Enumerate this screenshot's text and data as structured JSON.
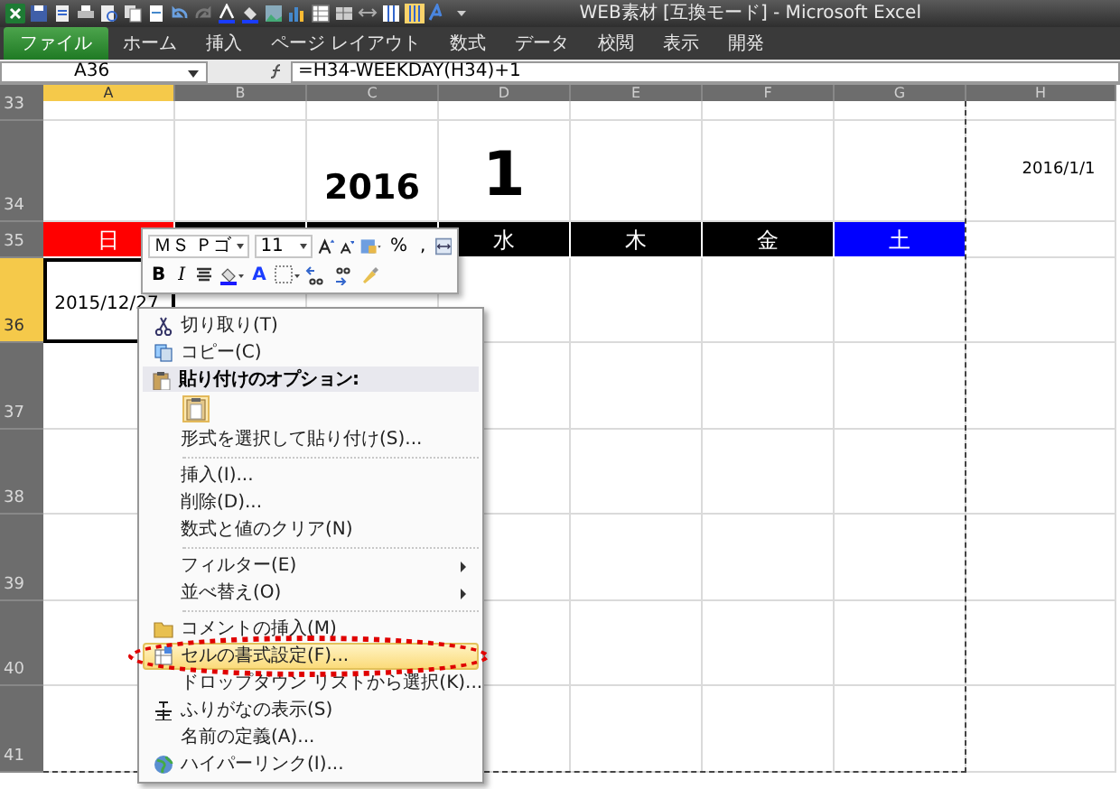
{
  "window": {
    "title": "WEB素材  [互換モード]  -  Microsoft Excel"
  },
  "tabs": [
    {
      "label": "ファイル",
      "selected": true
    },
    {
      "label": "ホーム",
      "selected": false
    },
    {
      "label": "挿入",
      "selected": false
    },
    {
      "label": "ページ レイアウト",
      "selected": false
    },
    {
      "label": "数式",
      "selected": false
    },
    {
      "label": "データ",
      "selected": false
    },
    {
      "label": "校閲",
      "selected": false
    },
    {
      "label": "表示",
      "selected": false
    },
    {
      "label": "開発",
      "selected": false
    }
  ],
  "formula_bar": {
    "name_box": "A36",
    "formula": "=H34-WEEKDAY(H34)+1"
  },
  "columns": [
    {
      "label": "A",
      "selected": true
    },
    {
      "label": "B",
      "selected": false
    },
    {
      "label": "C",
      "selected": false
    },
    {
      "label": "D",
      "selected": false
    },
    {
      "label": "E",
      "selected": false
    },
    {
      "label": "F",
      "selected": false
    },
    {
      "label": "G",
      "selected": false
    },
    {
      "label": "H",
      "selected": false
    }
  ],
  "rows": [
    {
      "label": "33",
      "selected": false,
      "cells": [
        {},
        {},
        {},
        {},
        {},
        {},
        {},
        {}
      ]
    },
    {
      "label": "34",
      "selected": false,
      "cells": [
        {},
        {},
        {
          "text": "2016"
        },
        {
          "text": "1"
        },
        {},
        {},
        {},
        {
          "text": "2016/1/1"
        }
      ]
    },
    {
      "label": "35",
      "selected": false,
      "cells": [
        {
          "text": "日",
          "color": "#ff0000"
        },
        {
          "color": "#000000"
        },
        {
          "color": "#000000"
        },
        {
          "text": "水",
          "color": "#000000"
        },
        {
          "text": "木",
          "color": "#000000"
        },
        {
          "text": "金",
          "color": "#000000"
        },
        {
          "text": "土",
          "color": "#0000ff"
        },
        {}
      ]
    },
    {
      "label": "36",
      "selected": true,
      "cells": [
        {
          "text": "2015/12/27"
        },
        {},
        {},
        {},
        {},
        {},
        {},
        {}
      ]
    },
    {
      "label": "37",
      "selected": false,
      "cells": [
        {},
        {},
        {},
        {},
        {},
        {},
        {},
        {}
      ]
    },
    {
      "label": "38",
      "selected": false,
      "cells": [
        {},
        {},
        {},
        {},
        {},
        {},
        {},
        {}
      ]
    },
    {
      "label": "39",
      "selected": false,
      "cells": [
        {},
        {},
        {},
        {},
        {},
        {},
        {},
        {}
      ]
    },
    {
      "label": "40",
      "selected": false,
      "cells": [
        {},
        {},
        {},
        {},
        {},
        {},
        {},
        {}
      ]
    },
    {
      "label": "41",
      "selected": false,
      "cells": [
        {},
        {},
        {},
        {},
        {},
        {},
        {},
        {}
      ]
    }
  ],
  "mini_toolbar": {
    "font_name": "ＭＳ Ｐゴ",
    "font_size": "11",
    "percent": "%",
    "comma": ",",
    "bold": "B",
    "italic": "I",
    "font_color": "A"
  },
  "context_menu": [
    {
      "kind": "item",
      "label": "切り取り(T)",
      "selected": false
    },
    {
      "kind": "item",
      "label": "コピー(C)",
      "selected": false
    },
    {
      "kind": "header",
      "label": "貼り付けのオプション:"
    },
    {
      "kind": "paste"
    },
    {
      "kind": "item",
      "label": "形式を選択して貼り付け(S)...",
      "selected": false
    },
    {
      "kind": "separator"
    },
    {
      "kind": "item",
      "label": "挿入(I)...",
      "selected": false
    },
    {
      "kind": "item",
      "label": "削除(D)...",
      "selected": false
    },
    {
      "kind": "item",
      "label": "数式と値のクリア(N)",
      "selected": false
    },
    {
      "kind": "separator"
    },
    {
      "kind": "item",
      "label": "フィルター(E)",
      "selected": false,
      "submenu": true
    },
    {
      "kind": "item",
      "label": "並べ替え(O)",
      "selected": false,
      "submenu": true
    },
    {
      "kind": "separator"
    },
    {
      "kind": "item",
      "label": "コメントの挿入(M)",
      "selected": false
    },
    {
      "kind": "item",
      "label": "セルの書式設定(F)...",
      "selected": true,
      "circled": true
    },
    {
      "kind": "item",
      "label": "ドロップダウン リストから選択(K)...",
      "selected": false
    },
    {
      "kind": "item",
      "label": "ふりがなの表示(S)",
      "selected": false
    },
    {
      "kind": "item",
      "label": "名前の定義(A)...",
      "selected": false
    },
    {
      "kind": "item",
      "label": "ハイパーリンク(I)...",
      "selected": false
    }
  ]
}
